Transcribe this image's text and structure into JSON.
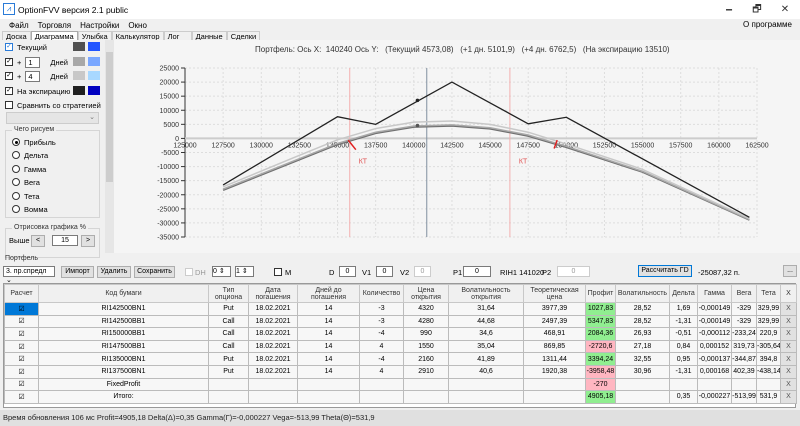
{
  "window": {
    "title": "OptionFVV версия 2.1 public",
    "minimize": "🗕",
    "restore": "🗗",
    "close": "✕"
  },
  "menu": {
    "items": [
      "Файл",
      "Торговля",
      "Настройки",
      "Окно"
    ],
    "about": "О программе"
  },
  "tabs": [
    "Доска",
    "Диаграмма",
    "Улыбка",
    "Калькулятор",
    "Лог",
    "Данные",
    "Сделки"
  ],
  "left": {
    "current_label": "Текущий",
    "plus": "+",
    "days": "Дней",
    "day1": "1",
    "day2": "4",
    "expiry_label": "На экспирацию",
    "compare_label": "Сравнить со стратегией",
    "colors": {
      "current": [
        "#505050",
        "#2255ff"
      ],
      "d1": [
        "#a8a8a8",
        "#7aa7ff"
      ],
      "d2": [
        "#c8c8c8",
        "#a8d8ff"
      ],
      "exp": [
        "#202020",
        "#0000c0"
      ]
    },
    "what_group": "Чего рисуем",
    "radios": [
      "Прибыль",
      "Дельта",
      "Гамма",
      "Вега",
      "Тета",
      "Вомма"
    ],
    "selected_radio": 0,
    "render_group": "Отрисовка графика %",
    "above_label": "Выше",
    "above_value": "15",
    "prev": "<",
    "next": ">"
  },
  "chart_info": "Портфель: Ось X:  140240 Ось Y:   (Текущий 4573,08)   (+1 дн. 5101,9)   (+4 дн. 6762,5)   (На экспирацию 13510)",
  "chart_data": {
    "type": "line",
    "xlim": [
      125000,
      162500
    ],
    "ylim": [
      -35000,
      25000
    ],
    "xticks": [
      "125000",
      "127500",
      "130000",
      "132500",
      "135000",
      "137500",
      "140000",
      "142500",
      "145000",
      "147500",
      "150000",
      "152500",
      "155000",
      "157500",
      "160000",
      "162500"
    ],
    "yticks": [
      "25000",
      "20000",
      "15000",
      "10000",
      "5000",
      "0",
      "-5000",
      "-10000",
      "-15000",
      "-20000",
      "-25000",
      "-30000",
      "-35000"
    ],
    "cursor_x": 140850,
    "kt_lines": [
      135800,
      146300
    ],
    "kt_label": "КТ",
    "series": [
      {
        "name": "На экспирацию",
        "color": "#222222",
        "points": [
          [
            127500,
            -16500
          ],
          [
            135000,
            7700
          ],
          [
            137500,
            5000
          ],
          [
            142500,
            20000
          ],
          [
            147500,
            5200
          ],
          [
            150000,
            7500
          ],
          [
            162000,
            -28000
          ]
        ]
      },
      {
        "name": "+4 дн.",
        "color": "#c8c8c8",
        "points": [
          [
            127500,
            -17200
          ],
          [
            132500,
            -6000
          ],
          [
            135000,
            -500
          ],
          [
            137500,
            3500
          ],
          [
            140000,
            5800
          ],
          [
            142500,
            6200
          ],
          [
            145000,
            5000
          ],
          [
            147500,
            2200
          ],
          [
            150000,
            -2000
          ],
          [
            155000,
            -11000
          ],
          [
            162000,
            -28400
          ]
        ]
      },
      {
        "name": "+1 дн.",
        "color": "#a8a8a8",
        "points": [
          [
            127500,
            -18000
          ],
          [
            132500,
            -7200
          ],
          [
            135000,
            -1800
          ],
          [
            137500,
            2200
          ],
          [
            140000,
            4400
          ],
          [
            142500,
            4800
          ],
          [
            145000,
            3800
          ],
          [
            147500,
            1200
          ],
          [
            150000,
            -2800
          ],
          [
            155000,
            -11700
          ],
          [
            162000,
            -28800
          ]
        ]
      },
      {
        "name": "Текущий",
        "color": "#707070",
        "points": [
          [
            127500,
            -18400
          ],
          [
            132500,
            -7600
          ],
          [
            135000,
            -2200
          ],
          [
            137500,
            1800
          ],
          [
            140000,
            4000
          ],
          [
            142500,
            4400
          ],
          [
            145000,
            3400
          ],
          [
            147500,
            800
          ],
          [
            150000,
            -3200
          ],
          [
            155000,
            -12000
          ],
          [
            162000,
            -29000
          ]
        ]
      }
    ]
  },
  "portfolio": {
    "group": "Портфель",
    "strategy": "3. пр.спредл",
    "import": "Импорт",
    "delete": "Удалить",
    "save": "Сохранить",
    "dh": "DH",
    "v0": "0",
    "v1": "1",
    "m": "M",
    "d_label": "D",
    "d": "0",
    "v1_label": "V1",
    "v1v": "0",
    "v2_label": "V2",
    "v2v": "0",
    "p1_label": "P1",
    "p1": "0",
    "ticker": "RIH1 141020",
    "p2_label": "P2",
    "p2": "0",
    "calc": "Рассчитать ГD",
    "total_sum": "-25087,32 п.",
    "dots": "..."
  },
  "table": {
    "headers": [
      "Расчет",
      "Код бумаги",
      "Тип опциона",
      "Дата погашения",
      "Дней до погашения",
      "Количество",
      "Цена открытия",
      "Волатильность открытия",
      "Теоретическая цена",
      "Профит",
      "Волатильность",
      "Дельта",
      "Гамма",
      "Вега",
      "Тета",
      "X"
    ],
    "rows": [
      {
        "check": "☑",
        "code": "RI142500BN1",
        "type": "Put",
        "date": "18.02.2021",
        "days": "14",
        "qty": "-3",
        "price": "4320",
        "vol_open": "31,64",
        "theo": "3977,39",
        "profit": "1027,83",
        "pos": true,
        "vol": "28,52",
        "delta": "1,69",
        "gamma": "-0,000149",
        "vega": "-329",
        "theta": "329,99",
        "x": "X"
      },
      {
        "check": "☑",
        "code": "RI142500BB1",
        "type": "Call",
        "date": "18.02.2021",
        "days": "14",
        "qty": "-3",
        "price": "4280",
        "vol_open": "44,68",
        "theo": "2497,39",
        "profit": "5347,83",
        "pos": true,
        "vol": "28,52",
        "delta": "-1,31",
        "gamma": "-0,000149",
        "vega": "-329",
        "theta": "329,99",
        "x": "X"
      },
      {
        "check": "☑",
        "code": "RI150000BB1",
        "type": "Call",
        "date": "18.02.2021",
        "days": "14",
        "qty": "-4",
        "price": "990",
        "vol_open": "34,6",
        "theo": "468,91",
        "profit": "2084,36",
        "pos": true,
        "vol": "26,93",
        "delta": "-0,51",
        "gamma": "-0,000112",
        "vega": "-233,24",
        "theta": "220,9",
        "x": "X"
      },
      {
        "check": "☑",
        "code": "RI147500BB1",
        "type": "Call",
        "date": "18.02.2021",
        "days": "14",
        "qty": "4",
        "price": "1550",
        "vol_open": "35,04",
        "theo": "869,85",
        "profit": "-2720,6",
        "pos": false,
        "vol": "27,18",
        "delta": "0,84",
        "gamma": "0,000152",
        "vega": "319,73",
        "theta": "-305,64",
        "x": "X"
      },
      {
        "check": "☑",
        "code": "RI135000BN1",
        "type": "Put",
        "date": "18.02.2021",
        "days": "14",
        "qty": "-4",
        "price": "2160",
        "vol_open": "41,89",
        "theo": "1311,44",
        "profit": "3394,24",
        "pos": true,
        "vol": "32,55",
        "delta": "0,95",
        "gamma": "-0,000137",
        "vega": "-344,87",
        "theta": "394,8",
        "x": "X"
      },
      {
        "check": "☑",
        "code": "RI137500BN1",
        "type": "Put",
        "date": "18.02.2021",
        "days": "14",
        "qty": "4",
        "price": "2910",
        "vol_open": "40,6",
        "theo": "1920,38",
        "profit": "-3958,48",
        "pos": false,
        "vol": "30,96",
        "delta": "-1,31",
        "gamma": "0,000168",
        "vega": "402,39",
        "theta": "-438,14",
        "x": "X"
      },
      {
        "check": "☑",
        "code": "FixedProfit",
        "type": "",
        "date": "",
        "days": "",
        "qty": "",
        "price": "",
        "vol_open": "",
        "theo": "",
        "profit": "-270",
        "pos": false,
        "vol": "",
        "delta": "",
        "gamma": "",
        "vega": "",
        "theta": "",
        "x": "X"
      },
      {
        "check": "☑",
        "code": "Итого:",
        "type": "",
        "date": "",
        "days": "",
        "qty": "",
        "price": "",
        "vol_open": "",
        "theo": "",
        "profit": "4905,18",
        "pos": true,
        "vol": "",
        "delta": "0,35",
        "gamma": "-0,000227",
        "vega": "-513,99",
        "theta": "531,9",
        "x": "X"
      }
    ]
  },
  "status": "Время обновления 106 мс   Profit=4905,18 Delta(Δ)=0,35 Gamma(Γ)=-0,000227 Vega=-513,99 Theta(Θ)=531,9"
}
